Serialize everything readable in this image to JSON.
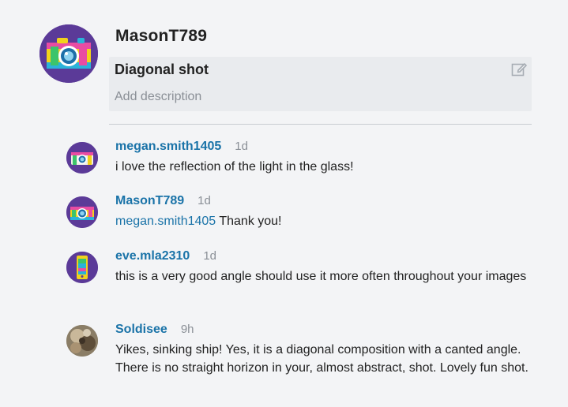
{
  "post": {
    "author": "MasonT789",
    "title": "Diagonal shot",
    "description_placeholder": "Add description"
  },
  "icons": {
    "author_avatar": "camera-avatar-icon",
    "edit": "edit-icon"
  },
  "comments": [
    {
      "user": "megan.smith1405",
      "time": "1d",
      "text": "i love the reflection of the light in the glass!",
      "avatar": "camera-avatar-icon"
    },
    {
      "user": "MasonT789",
      "time": "1d",
      "mention": "megan.smith1405",
      "text": "Thank you!",
      "avatar": "camera-avatar-icon"
    },
    {
      "user": "eve.mla2310",
      "time": "1d",
      "text": "this is a very good angle should use it more often throughout your images",
      "avatar": "phone-avatar-icon"
    },
    {
      "user": "Soldisee",
      "time": "9h",
      "text": "Yikes, sinking ship! Yes, it is a diagonal composition with a canted angle. There is no straight horizon in your, almost abstract, shot. Lovely fun shot.",
      "avatar": "photo-avatar-icon"
    }
  ],
  "colors": {
    "background": "#f3f4f6",
    "link": "#1a73a8",
    "avatar_bg": "#5b3a98"
  }
}
